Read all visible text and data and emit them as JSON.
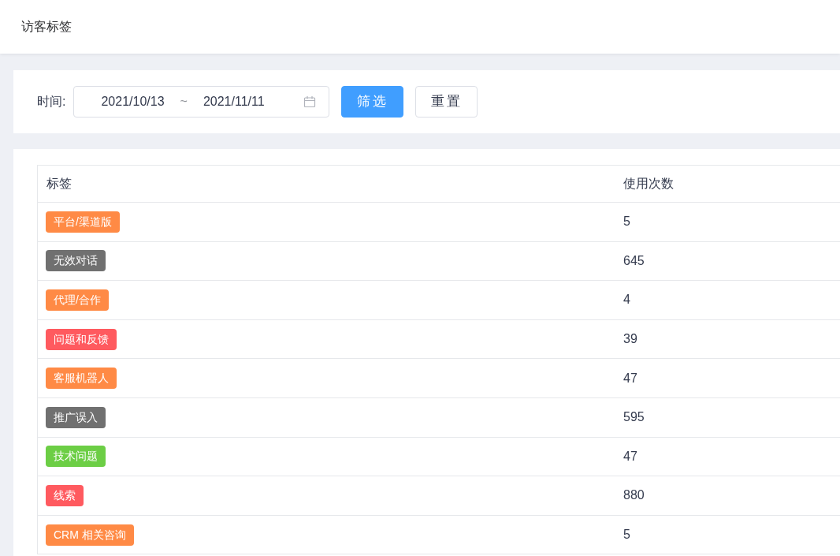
{
  "page_title": "访客标签",
  "filter": {
    "label": "时间:",
    "start_date": "2021/10/13",
    "separator": "~",
    "end_date": "2021/11/11",
    "buttons": [
      {
        "label": "筛选",
        "kind": "primary"
      },
      {
        "label": "重置",
        "kind": "default"
      }
    ]
  },
  "table": {
    "columns": [
      "标签",
      "使用次数"
    ],
    "rows": [
      {
        "tag": "平台/渠道版",
        "color": "#ff8a45",
        "count": "5"
      },
      {
        "tag": "无效对话",
        "color": "#707070",
        "count": "645"
      },
      {
        "tag": "代理/合作",
        "color": "#ff8a45",
        "count": "4"
      },
      {
        "tag": "问题和反馈",
        "color": "#ff5a5f",
        "count": "39"
      },
      {
        "tag": "客服机器人",
        "color": "#ff8a45",
        "count": "47"
      },
      {
        "tag": "推广误入",
        "color": "#707070",
        "count": "595"
      },
      {
        "tag": "技术问题",
        "color": "#6cce45",
        "count": "47"
      },
      {
        "tag": "线索",
        "color": "#ff5a5f",
        "count": "880"
      },
      {
        "tag": "CRM 相关咨询",
        "color": "#ff8a45",
        "count": "5"
      }
    ]
  }
}
